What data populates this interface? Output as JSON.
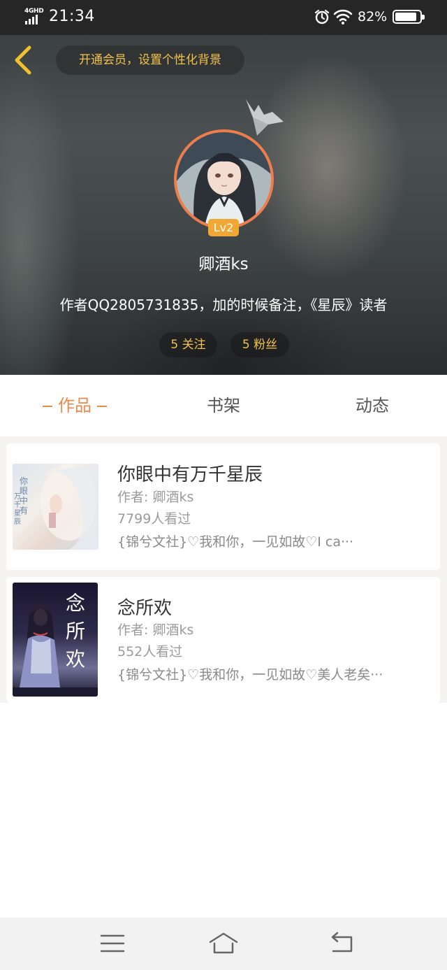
{
  "status_bar": {
    "network": "4GHD",
    "time": "21:34",
    "battery": "82%",
    "icons": [
      "alarm-icon",
      "wifi-icon",
      "battery-icon"
    ]
  },
  "header": {
    "vip_banner": "开通会员，设置个性化背景",
    "level": "Lv2",
    "username": "卿酒ks",
    "bio": "作者QQ2805731835，加的时候备注，《星辰》读者",
    "following": "5 关注",
    "fans": "5 粉丝"
  },
  "tabs": {
    "works": "作品",
    "shelf": "书架",
    "activity": "动态"
  },
  "books": [
    {
      "title": "你眼中有万千星辰",
      "author": "作者: 卿酒ks",
      "views": "7799人看过",
      "desc": "{锦兮文社}♡我和你，一见如故♡I ca···",
      "cover_text": [
        "你",
        "眼",
        "中",
        "有",
        "万",
        "千",
        "星",
        "辰"
      ]
    },
    {
      "title": "念所欢",
      "author": "作者: 卿酒ks",
      "views": "552人看过",
      "desc": "{锦兮文社}♡我和你，一见如故♡美人老矣···",
      "cover_text": "念所欢"
    }
  ],
  "colors": {
    "accent": "#ec8a4c",
    "gold": "#f2c24a",
    "avatar_border": "#ee7d4a",
    "level_badge": "#f1a733"
  }
}
